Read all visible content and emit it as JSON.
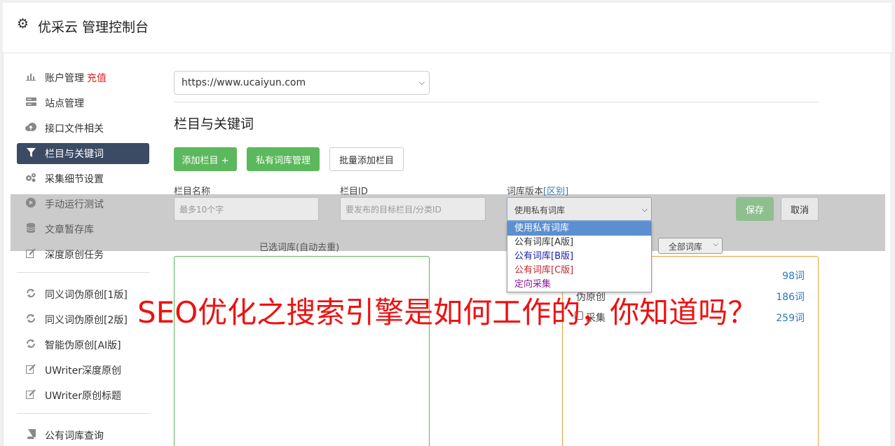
{
  "app": {
    "title": "优采云 管理控制台",
    "icon": "gear-icon"
  },
  "sidebar": {
    "items": [
      {
        "label": "账户管理",
        "badge": "充值",
        "icon": "bar-chart-icon"
      },
      {
        "label": "站点管理",
        "icon": "server-icon"
      },
      {
        "label": "接口文件相关",
        "icon": "cloud-upload-icon"
      },
      {
        "label": "栏目与关键词",
        "icon": "filter-icon",
        "active": true
      },
      {
        "label": "采集细节设置",
        "icon": "cogs-icon"
      },
      {
        "label": "手动运行测试",
        "icon": "play-icon"
      },
      {
        "label": "文章暂存库",
        "icon": "database-icon"
      },
      {
        "label": "深度原创任务",
        "icon": "edit-icon"
      }
    ],
    "items2": [
      {
        "label": "同义词伪原创[1版]",
        "icon": "refresh-icon"
      },
      {
        "label": "同义词伪原创[2版]",
        "icon": "refresh-icon"
      },
      {
        "label": "智能伪原创[AI版]",
        "icon": "refresh-icon"
      },
      {
        "label": "UWriter深度原创",
        "icon": "edit-icon"
      },
      {
        "label": "UWriter原创标题",
        "icon": "edit-icon"
      }
    ],
    "items3": [
      {
        "label": "公有词库查询",
        "icon": "book-icon"
      }
    ]
  },
  "main": {
    "site_select": "https://www.ucaiyun.com",
    "section_title": "栏目与关键词",
    "buttons": {
      "add_column": "添加栏目 +",
      "private_lib": "私有词库管理",
      "batch_add": "批量添加栏目"
    },
    "form": {
      "name_label": "栏目名称",
      "name_placeholder": "最多10个字",
      "id_label": "栏目ID",
      "id_placeholder": "要发布的目标栏目/分类ID",
      "lib_label": "词库版本",
      "lib_diff_link": "[区别]",
      "lib_value": "使用私有词库",
      "save": "保存",
      "cancel": "取消"
    },
    "dropdown_options": [
      {
        "label": "使用私有词库",
        "color": "#ffffff",
        "selected": true
      },
      {
        "label": "公有词库[A版]",
        "color": "#333333"
      },
      {
        "label": "公有词库[B版]",
        "color": "#1a1aa8"
      },
      {
        "label": "公有词库[C版]",
        "color": "#c0272d"
      },
      {
        "label": "定向采集",
        "color": "#8a1a9a"
      }
    ],
    "selected_lib_title": "已选词库(自动去重)",
    "lib_filter": "全部词库",
    "libraries": [
      {
        "name": "",
        "count": "98词"
      },
      {
        "name": "伪原创",
        "count": "186词"
      },
      {
        "name": "采集",
        "count": "259词"
      }
    ]
  },
  "overlay_caption": "SEO优化之搜索引擎是如何工作的，你知道吗？",
  "colors": {
    "accent_green": "#5cb85c",
    "active_nav": "#3c4b64",
    "link_blue": "#337ab7",
    "caption_red": "#ee1111"
  }
}
